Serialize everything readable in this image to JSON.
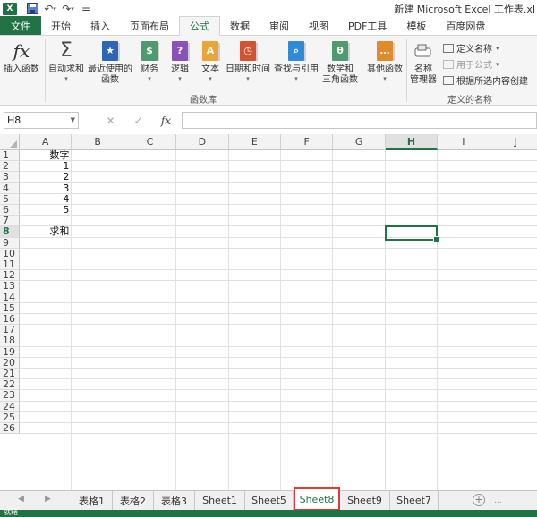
{
  "window": {
    "title": "新建 Microsoft Excel 工作表.xl"
  },
  "qat": {
    "logo": "X",
    "undo": "↶",
    "redo": "↷",
    "customize": "="
  },
  "tabs": [
    {
      "label": "文件"
    },
    {
      "label": "开始"
    },
    {
      "label": "插入"
    },
    {
      "label": "页面布局"
    },
    {
      "label": "公式"
    },
    {
      "label": "数据"
    },
    {
      "label": "审阅"
    },
    {
      "label": "视图"
    },
    {
      "label": "PDF工具"
    },
    {
      "label": "模板"
    },
    {
      "label": "百度网盘"
    }
  ],
  "ribbon": {
    "insert_function": {
      "label": "插入函数",
      "icon_glyph": "fx"
    },
    "autosum": {
      "label": "自动求和",
      "icon_glyph": "Σ"
    },
    "recent": {
      "label1": "最近使用的",
      "label2": "函数",
      "icon_glyph": "★"
    },
    "financial": {
      "label": "财务",
      "icon_glyph": "$"
    },
    "logical": {
      "label": "逻辑",
      "icon_glyph": "?"
    },
    "text": {
      "label": "文本",
      "icon_glyph": "A"
    },
    "datetime": {
      "label": "日期和时间",
      "icon_glyph": "◷"
    },
    "lookup": {
      "label": "查找与引用",
      "icon_glyph": "⌕"
    },
    "math": {
      "label1": "数学和",
      "label2": "三角函数",
      "icon_glyph": "θ"
    },
    "more": {
      "label": "其他函数",
      "icon_glyph": "…"
    },
    "group_library": "函数库",
    "name_manager": {
      "label1": "名称",
      "label2": "管理器"
    },
    "define_name": "定义名称",
    "use_in_formula": "用于公式",
    "create_from_selection": "根据所选内容创建",
    "group_names": "定义的名称",
    "colors": {
      "recent": "#2f66b3",
      "financial": "#4f9a6e",
      "logical": "#8a52b6",
      "text": "#e9a53a",
      "datetime": "#d35230",
      "lookup": "#2f8ad8",
      "math": "#4f9a6e",
      "more": "#e08a2a"
    }
  },
  "formula_bar": {
    "name_box": "H8",
    "cancel": "✕",
    "enter": "✓",
    "fx": "fx",
    "formula": ""
  },
  "grid": {
    "columns": [
      "A",
      "B",
      "C",
      "D",
      "E",
      "F",
      "G",
      "H",
      "I",
      "J"
    ],
    "selected_column": "H",
    "rows": [
      "1",
      "2",
      "3",
      "4",
      "5",
      "6",
      "7",
      "8",
      "9",
      "10",
      "11",
      "12",
      "13",
      "14",
      "15",
      "16",
      "17",
      "18",
      "19",
      "20",
      "21",
      "22",
      "23",
      "24",
      "25",
      "26"
    ],
    "selected_row": "8",
    "cells": {
      "A1": "数字",
      "A2": "1",
      "A3": "2",
      "A4": "3",
      "A5": "4",
      "A6": "5",
      "A8": "求和"
    },
    "active_cell": "H8"
  },
  "sheets": {
    "tabs": [
      "表格1",
      "表格2",
      "表格3",
      "Sheet1",
      "Sheet5",
      "Sheet8",
      "Sheet9",
      "Sheet7"
    ],
    "active": "Sheet8",
    "add": "+",
    "scroll_left": "◀",
    "scroll_right": "▶",
    "more": "..."
  },
  "status": {
    "text": "就绪",
    "accent": "#217346"
  }
}
